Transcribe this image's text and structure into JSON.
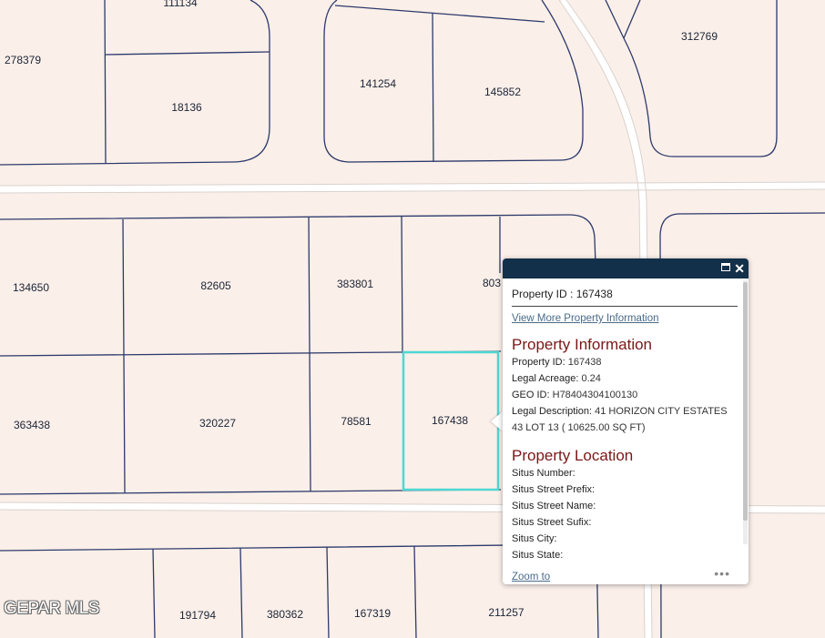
{
  "map": {
    "parcels": [
      {
        "label": "111134"
      },
      {
        "label": "278379"
      },
      {
        "label": "18136"
      },
      {
        "label": "141254"
      },
      {
        "label": "145852"
      },
      {
        "label": "312769"
      },
      {
        "label": "134650"
      },
      {
        "label": "82605"
      },
      {
        "label": "383801"
      },
      {
        "label": "803"
      },
      {
        "label": "363438"
      },
      {
        "label": "320227"
      },
      {
        "label": "78581"
      },
      {
        "label": "167438"
      },
      {
        "label": "191794"
      },
      {
        "label": "380362"
      },
      {
        "label": "167319"
      },
      {
        "label": "211257"
      }
    ],
    "selected_parcel": "167438",
    "colors": {
      "background": "#fbefe9",
      "parcel_line": "#2c3a6b",
      "road": "#ffffff",
      "selection": "#4fd7d2"
    }
  },
  "watermark": "GEPAR MLS",
  "popup": {
    "title_label": "Property ID",
    "title_value": "167438",
    "view_more": "View More Property Information",
    "info_heading": "Property Information",
    "info_fields": [
      {
        "key": "Property ID:",
        "value": "167438"
      },
      {
        "key": "Legal Acreage:",
        "value": "0.24"
      },
      {
        "key": "GEO ID:",
        "value": "H78404304100130"
      },
      {
        "key": "Legal Description:",
        "value": "41 HORIZON CITY ESTATES 43 LOT 13 ( 10625.00 SQ FT)"
      }
    ],
    "location_heading": "Property Location",
    "location_fields": [
      {
        "key": "Situs Number:",
        "value": ""
      },
      {
        "key": "Situs Street Prefix:",
        "value": ""
      },
      {
        "key": "Situs Street Name:",
        "value": ""
      },
      {
        "key": "Situs Street Sufix:",
        "value": ""
      },
      {
        "key": "Situs City:",
        "value": ""
      },
      {
        "key": "Situs State:",
        "value": ""
      }
    ],
    "zoom_to": "Zoom to",
    "header_color": "#13304a",
    "heading_color": "#7a1717"
  }
}
